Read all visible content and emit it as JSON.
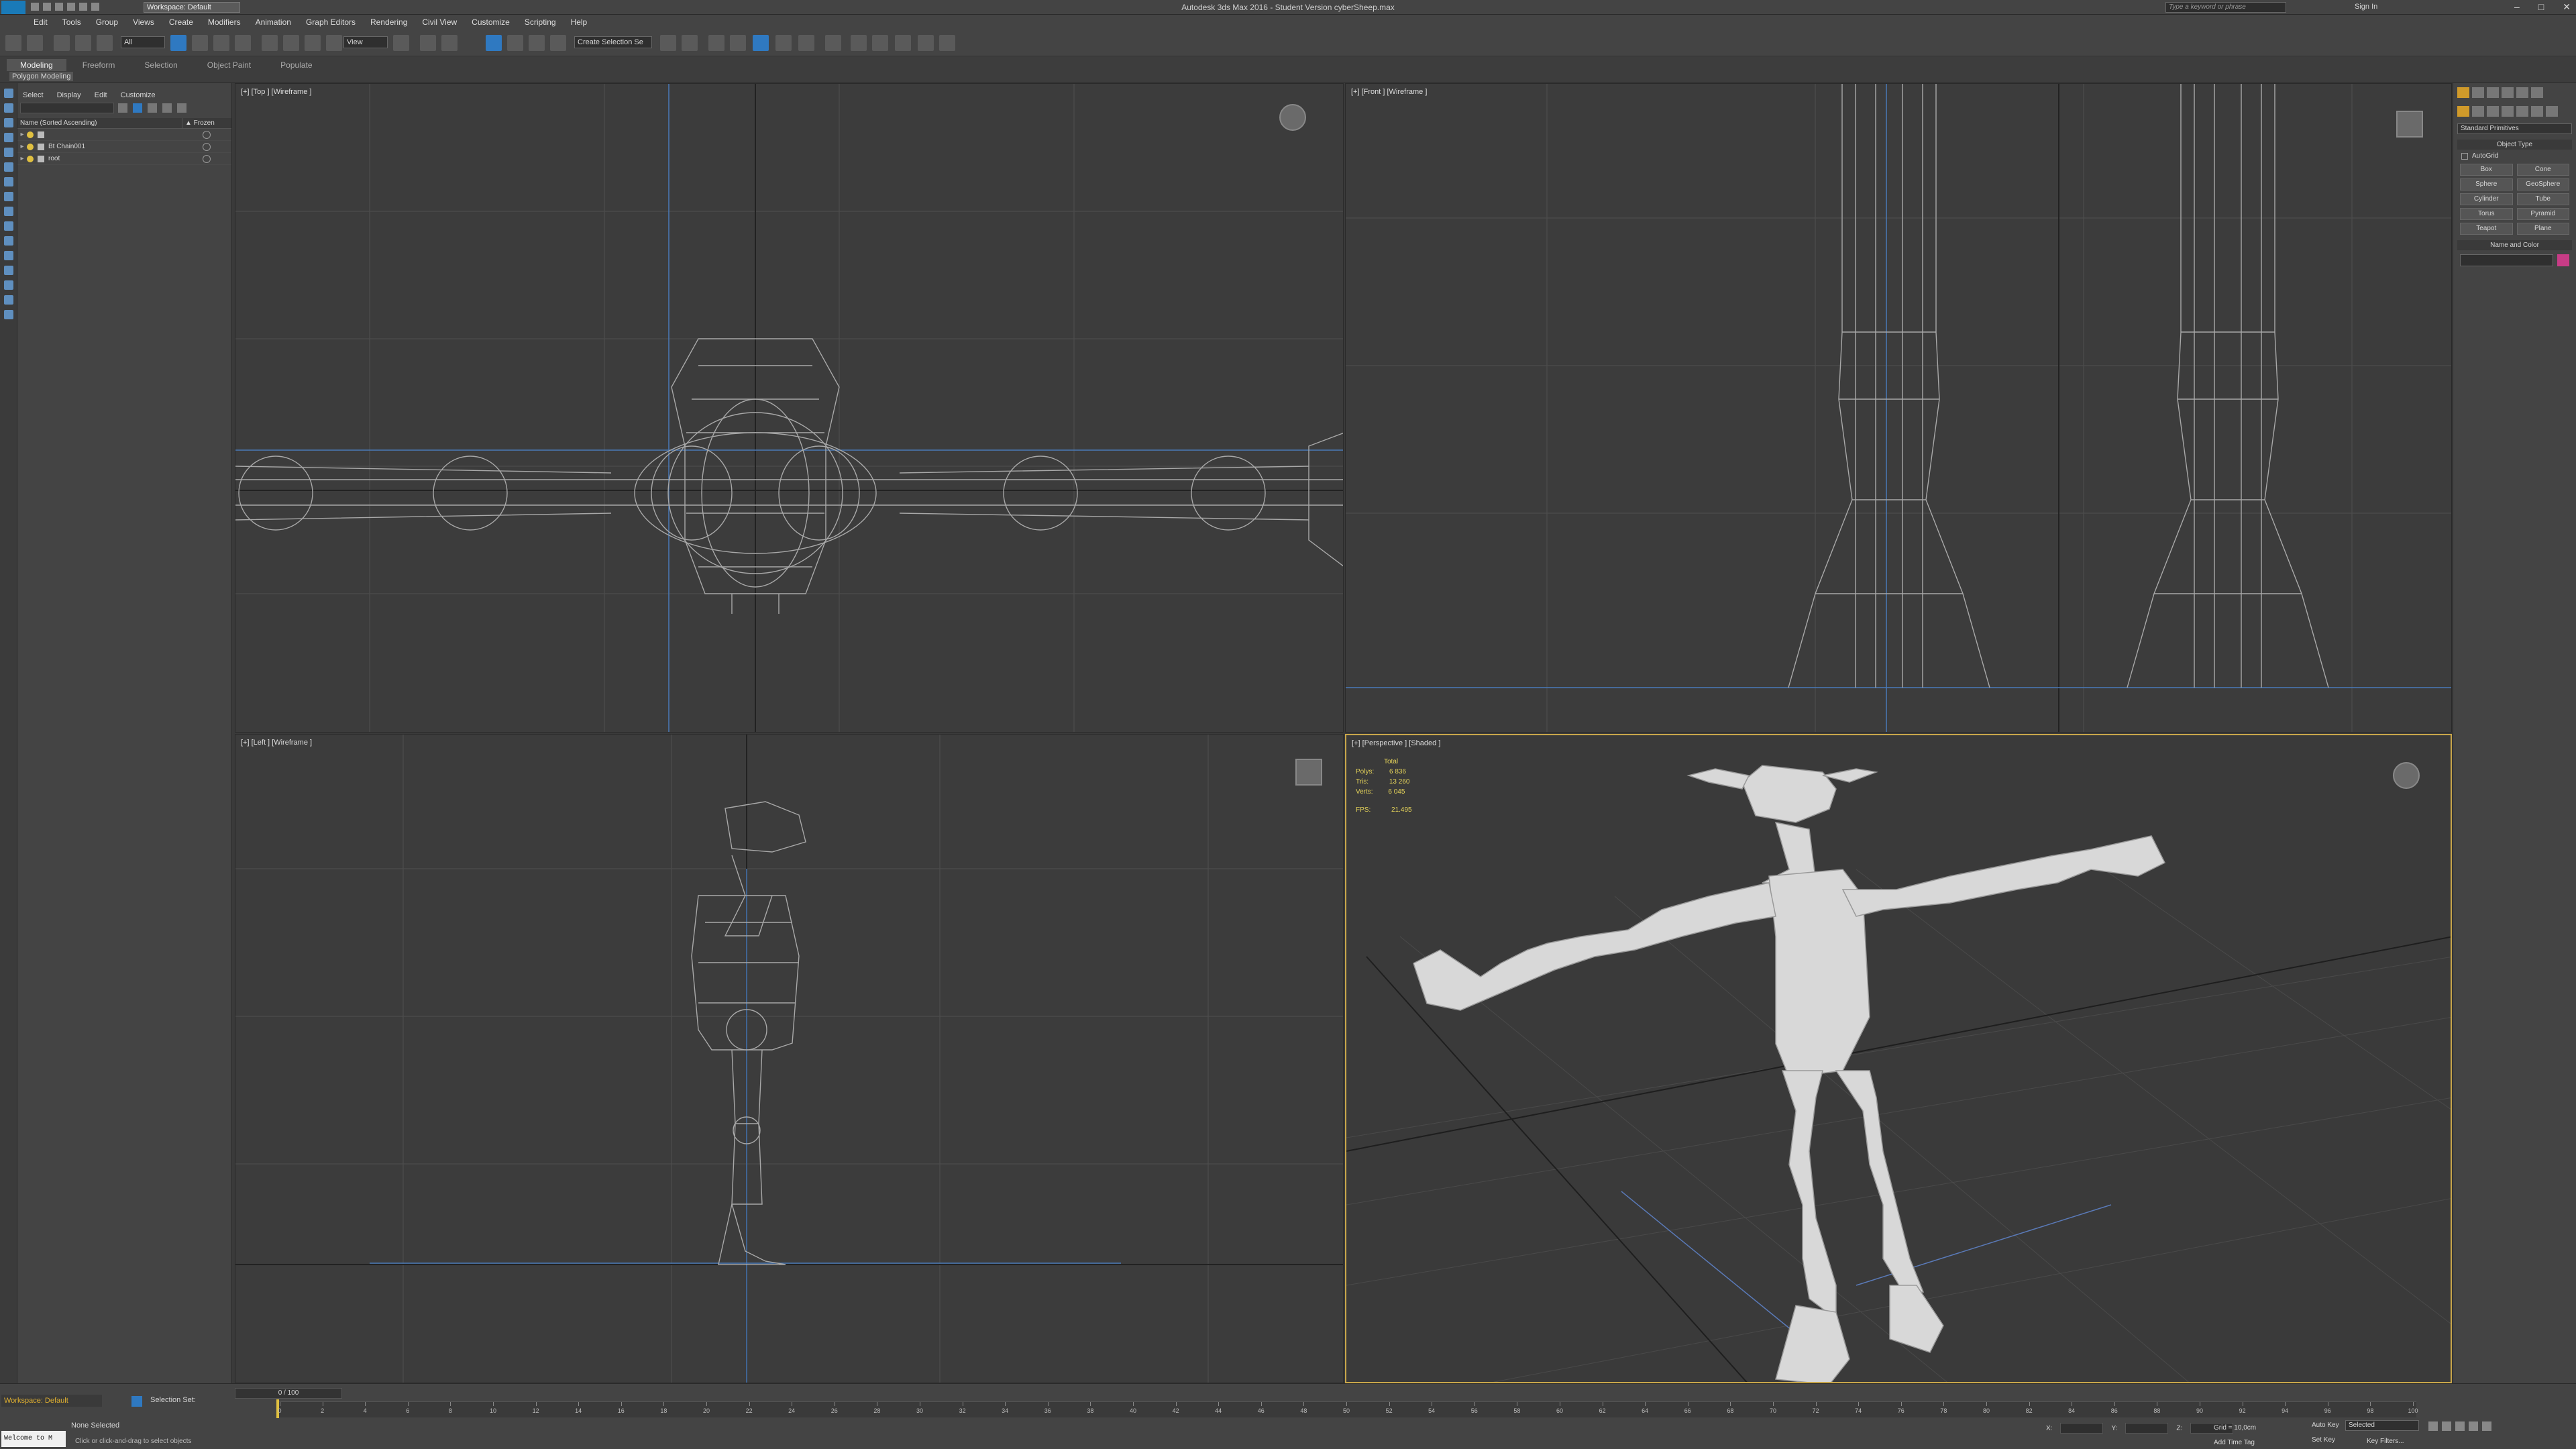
{
  "titlebar": {
    "workspace": "Workspace: Default",
    "title": "Autodesk 3ds Max 2016 - Student Version   cyberSheep.max",
    "search_placeholder": "Type a keyword or phrase",
    "sign_in": "Sign In"
  },
  "menu": [
    "Edit",
    "Tools",
    "Group",
    "Views",
    "Create",
    "Modifiers",
    "Animation",
    "Graph Editors",
    "Rendering",
    "Civil View",
    "Customize",
    "Scripting",
    "Help"
  ],
  "toolbar": {
    "selection_filter": "All",
    "ref_coord": "View",
    "named_selection": "Create Selection Se"
  },
  "ribbon": {
    "tabs": [
      "Modeling",
      "Freeform",
      "Selection",
      "Object Paint",
      "Populate"
    ],
    "active_tab": "Modeling",
    "subtab": "Polygon Modeling"
  },
  "explorer": {
    "menus": [
      "Select",
      "Display",
      "Edit",
      "Customize"
    ],
    "col_name": "Name (Sorted Ascending)",
    "col_frozen": "▲ Frozen",
    "rows": [
      "",
      "Bt Chain001",
      "root"
    ]
  },
  "viewports": {
    "top": "[+] [Top ] [Wireframe ]",
    "front": "[+] [Front ] [Wireframe ]",
    "left": "[+] [Left ] [Wireframe ]",
    "persp": "[+] [Perspective ] [Shaded ]"
  },
  "stats": {
    "header": "Total",
    "polys_label": "Polys:",
    "polys": "6 836",
    "tris_label": "Tris:",
    "tris": "13 260",
    "verts_label": "Verts:",
    "verts": "6 045",
    "fps_label": "FPS:",
    "fps": "21.495"
  },
  "cmdpanel": {
    "dropdown": "Standard Primitives",
    "object_type": "Object Type",
    "autogrid": "AutoGrid",
    "buttons": [
      "Box",
      "Cone",
      "Sphere",
      "GeoSphere",
      "Cylinder",
      "Tube",
      "Torus",
      "Pyramid",
      "Teapot",
      "Plane"
    ],
    "name_and_color": "Name and Color",
    "color": "#c83c86"
  },
  "bottom": {
    "workspace": "Workspace: Default",
    "selection_set": "Selection Set:",
    "time_slider": "0 / 100",
    "timeline_ticks": [
      0,
      2,
      4,
      6,
      8,
      10,
      12,
      14,
      16,
      18,
      20,
      22,
      24,
      26,
      28,
      30,
      32,
      34,
      36,
      38,
      40,
      42,
      44,
      46,
      48,
      50,
      52,
      54,
      56,
      58,
      60,
      62,
      64,
      66,
      68,
      70,
      72,
      74,
      76,
      78,
      80,
      82,
      84,
      86,
      88,
      90,
      92,
      94,
      96,
      98,
      100
    ],
    "status_selected": "None Selected",
    "status_prompt": "Click or click-and-drag to select objects",
    "maxscript": "Welcome to M",
    "grid": "Grid = 10,0cm",
    "auto_key": "Auto Key",
    "set_key": "Set Key",
    "add_time_tag": "Add Time Tag",
    "key_selected": "Selected",
    "key_filters": "Key Filters...",
    "coord_x": "X:",
    "coord_y": "Y:",
    "coord_z": "Z:"
  }
}
